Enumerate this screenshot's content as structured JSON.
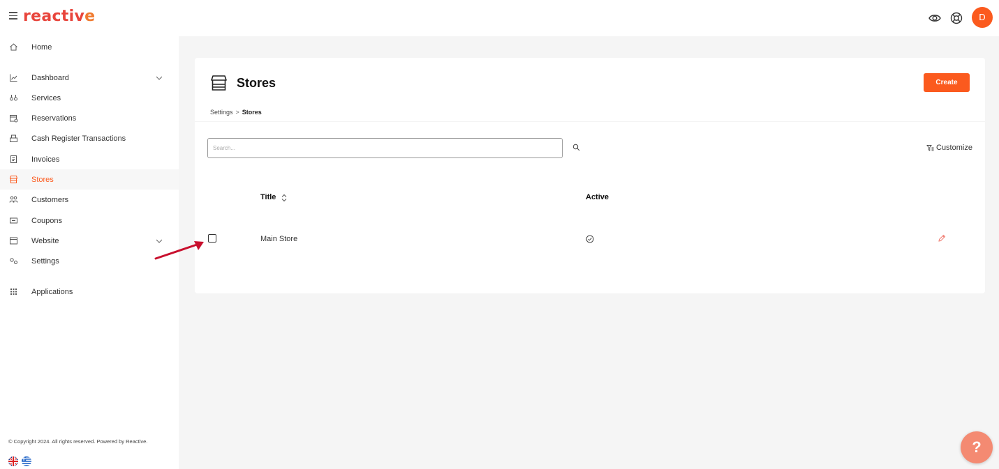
{
  "app": {
    "logo_text_main": "reactiv",
    "logo_text_accent": "e",
    "user_initial": "D"
  },
  "sidebar": {
    "items": [
      {
        "label": "Home",
        "icon": "home-icon"
      },
      {
        "label": "Dashboard",
        "icon": "chart-icon"
      },
      {
        "label": "Services",
        "icon": "services-icon"
      },
      {
        "label": "Reservations",
        "icon": "calendar-icon"
      },
      {
        "label": "Cash Register Transactions",
        "icon": "register-icon"
      },
      {
        "label": "Invoices",
        "icon": "invoice-icon"
      },
      {
        "label": "Stores",
        "icon": "store-icon"
      },
      {
        "label": "Customers",
        "icon": "customers-icon"
      },
      {
        "label": "Coupons",
        "icon": "coupon-icon"
      },
      {
        "label": "Website",
        "icon": "website-icon"
      },
      {
        "label": "Settings",
        "icon": "settings-icon"
      },
      {
        "label": "Applications",
        "icon": "grid-icon"
      }
    ],
    "footer": "© Copyright 2024. All rights reserved. Powered by Reactive."
  },
  "page": {
    "title": "Stores",
    "create_label": "Create",
    "breadcrumb": {
      "parent": "Settings",
      "current": "Stores"
    },
    "search_placeholder": "Search...",
    "customize_label": "Customize"
  },
  "table": {
    "columns": {
      "title": "Title",
      "active": "Active"
    },
    "rows": [
      {
        "title": "Main Store",
        "active": true
      }
    ]
  },
  "colors": {
    "accent": "#fb5a1e",
    "logo": "#e8453c",
    "help": "#f48a72"
  },
  "help_label": "?"
}
